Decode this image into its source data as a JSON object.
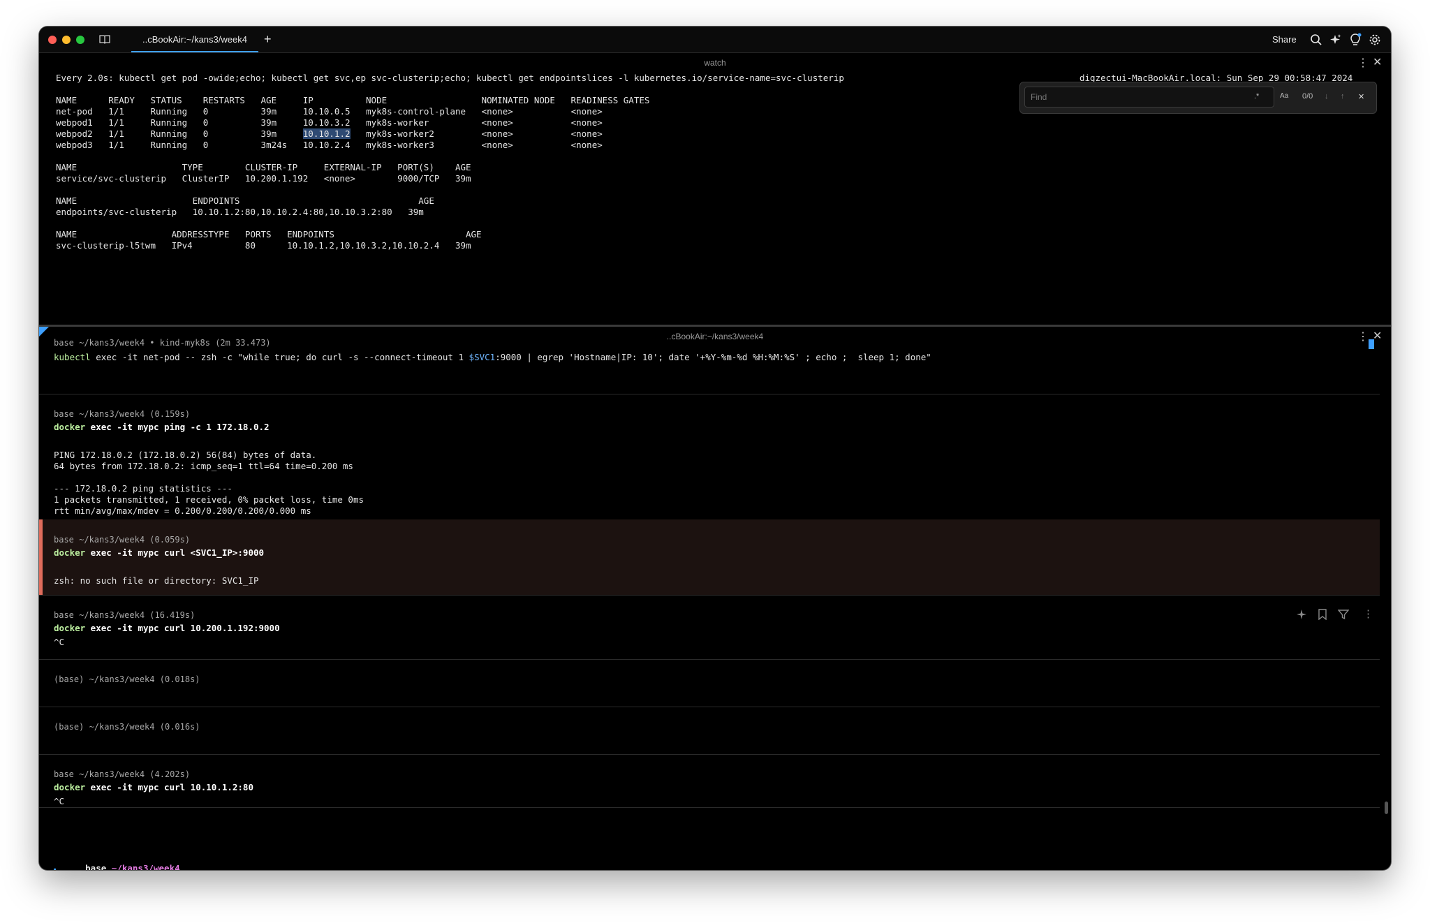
{
  "titlebar": {
    "tab_label": "..cBookAir:~/kans3/week4",
    "new_tab": "+",
    "share_label": "Share"
  },
  "top_pane": {
    "title": "watch",
    "header_cmd": "Every 2.0s: kubectl get pod -owide;echo; kubectl get svc,ep svc-clusterip;echo; kubectl get endpointslices -l kubernetes.io/service-name=svc-clusterip",
    "header_right": "digzectui-MacBookAir.local: Sun Sep 29 00:58:47 2024",
    "pods_header": "NAME      READY   STATUS    RESTARTS   AGE     IP          NODE                  NOMINATED NODE   READINESS GATES",
    "pods": [
      {
        "name": "net-pod",
        "ready": "1/1",
        "status": "Running",
        "restarts": "0",
        "age": "39m",
        "ip": "10.10.0.5",
        "node": "myk8s-control-plane",
        "nominated": "<none>",
        "gates": "<none>"
      },
      {
        "name": "webpod1",
        "ready": "1/1",
        "status": "Running",
        "restarts": "0",
        "age": "39m",
        "ip": "10.10.3.2",
        "node": "myk8s-worker",
        "nominated": "<none>",
        "gates": "<none>"
      },
      {
        "name": "webpod2",
        "ready": "1/1",
        "status": "Running",
        "restarts": "0",
        "age": "39m",
        "ip": "10.10.1.2",
        "node": "myk8s-worker2",
        "nominated": "<none>",
        "gates": "<none>"
      },
      {
        "name": "webpod3",
        "ready": "1/1",
        "status": "Running",
        "restarts": "0",
        "age": "3m24s",
        "ip": "10.10.2.4",
        "node": "myk8s-worker3",
        "nominated": "<none>",
        "gates": "<none>"
      }
    ],
    "svc_header": "NAME                    TYPE        CLUSTER-IP     EXTERNAL-IP   PORT(S)    AGE",
    "svc_row": "service/svc-clusterip   ClusterIP   10.200.1.192   <none>        9000/TCP   39m",
    "ep_header": "NAME                      ENDPOINTS                                  AGE",
    "ep_row": "endpoints/svc-clusterip   10.10.1.2:80,10.10.2.4:80,10.10.3.2:80   39m",
    "eps_header": "NAME                  ADDRESSTYPE   PORTS   ENDPOINTS                         AGE",
    "eps_row": "svc-clusterip-l5twm   IPv4          80      10.10.1.2,10.10.3.2,10.10.2.4   39m"
  },
  "find": {
    "placeholder": "Find",
    "regex": ".*",
    "case": "Aa",
    "count": "0/0"
  },
  "bottom_pane": {
    "title": "..cBookAir:~/kans3/week4",
    "partial_meta": "base ~/kans3/week4 • kind-myk8s (2m 33.473)",
    "blocks": [
      {
        "cmd_kw": "kubectl",
        "cmd_rest": " exec -it net-pod -- zsh -c \"while true; do curl -s --connect-timeout 1 ",
        "cmd_var": "$SVC1",
        "cmd_tail": ":9000 | egrep 'Hostname|IP: 10'; date '+%Y-%m-%d %H:%M:%S' ; echo ;  sleep 1; done\""
      },
      {
        "meta": "base ~/kans3/week4 (0.159s)",
        "cmd_kw": "docker",
        "cmd_rest": " exec -it mypc ping -c 1 172.18.0.2",
        "output": "PING 172.18.0.2 (172.18.0.2) 56(84) bytes of data.\n64 bytes from 172.18.0.2: icmp_seq=1 ttl=64 time=0.200 ms\n\n--- 172.18.0.2 ping statistics ---\n1 packets transmitted, 1 received, 0% packet loss, time 0ms\nrtt min/avg/max/mdev = 0.200/0.200/0.200/0.000 ms"
      },
      {
        "meta": "base ~/kans3/week4 (0.059s)",
        "cmd_kw": "docker",
        "cmd_rest": " exec -it mypc curl <SVC1_IP>:9000",
        "output": "zsh: no such file or directory: SVC1_IP"
      },
      {
        "meta": "base ~/kans3/week4 (16.419s)",
        "cmd_kw": "docker",
        "cmd_rest": " exec -it mypc curl 10.200.1.192:9000",
        "output": "^C"
      },
      {
        "meta": "(base) ~/kans3/week4 (0.018s)"
      },
      {
        "meta": "(base) ~/kans3/week4 (0.016s)"
      },
      {
        "meta": "base ~/kans3/week4 (4.202s)",
        "cmd_kw": "docker",
        "cmd_rest": " exec -it mypc curl 10.10.1.2:80",
        "output": "^C"
      }
    ],
    "prompt_base": "base",
    "prompt_path": "~/kans3/week4"
  },
  "colors": {
    "accent": "#3ea0ff",
    "error_bar": "#e06c5c",
    "command_keyword": "#bdf0a0",
    "prompt_path": "#e27be0"
  }
}
